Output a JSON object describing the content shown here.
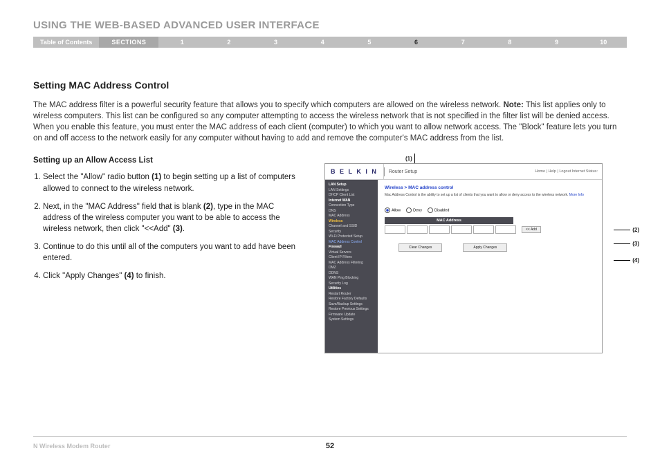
{
  "header": {
    "title": "USING THE WEB-BASED ADVANCED USER INTERFACE"
  },
  "nav": {
    "toc": "Table of Contents",
    "sections": "SECTIONS",
    "items": [
      "1",
      "2",
      "3",
      "4",
      "5",
      "6",
      "7",
      "8",
      "9",
      "10"
    ],
    "active": "6"
  },
  "section": {
    "title": "Setting MAC Address Control"
  },
  "intro": {
    "p1a": "The MAC address filter is a powerful security feature that allows you to specify which computers are allowed on the wireless network. ",
    "noteLabel": "Note:",
    "p1b": " This list applies only to wireless computers. This list can be configured so any computer attempting to access the wireless network that is not specified in the filter list will be denied access. When you enable this feature, you must enter the MAC address of each client (computer) to which you want to allow network access. The \"Block\" feature lets you turn on and off access to the network easily for any computer without having to add and remove the computer's MAC address from the list."
  },
  "sub": {
    "title": "Setting up an Allow Access List"
  },
  "steps": [
    {
      "a": "Select the \"Allow\" radio button ",
      "b": "(1)",
      "c": " to begin setting up a list of computers allowed to connect to the wireless network."
    },
    {
      "a": "Next, in the \"MAC Address\" field that is blank ",
      "b": "(2)",
      "c": ", type in the MAC address of the wireless computer you want to be able to access the wireless network, then click \"<<Add\" ",
      "d": "(3)",
      "e": "."
    },
    {
      "a": "Continue to do this until all of the computers you want to add have been entered.",
      "b": "",
      "c": ""
    },
    {
      "a": "Click \"Apply Changes\" ",
      "b": "(4)",
      "c": " to finish."
    }
  ],
  "callouts": {
    "c1": "(1)",
    "c2": "(2)",
    "c3": "(3)",
    "c4": "(4)"
  },
  "shot": {
    "logo": "B E L K I N",
    "rsetup": "Router Setup",
    "toplinks": "Home | Help | Logout  Internet Status:",
    "sidebar": {
      "g1": "LAN Setup",
      "g1a": "LAN Settings",
      "g1b": "DHCP Client List",
      "g2": "Internet WAN",
      "g2a": "Connection Type",
      "g2b": "DNS",
      "g2c": "MAC Address",
      "g3": "Wireless",
      "g3a": "Channel and SSID",
      "g3b": "Security",
      "g3c": "Wi-Fi Protected Setup",
      "g3d": "MAC Address Control",
      "g4": "Firewall",
      "g4a": "Virtual Servers",
      "g4b": "Client IP Filters",
      "g4c": "MAC Address Filtering",
      "g4d": "DMZ",
      "g4e": "DDNS",
      "g4f": "WAN Ping Blocking",
      "g4g": "Security Log",
      "g5": "Utilities",
      "g5a": "Restart Router",
      "g5b": "Restore Factory Defaults",
      "g5c": "Save/Backup Settings",
      "g5d": "Restore Previous Settings",
      "g5e": "Firmware Update",
      "g5f": "System Settings"
    },
    "main": {
      "crumb": "Wireless > MAC address control",
      "desc": "Mac Address Control is the ability to set up a list of clients that you want to allow or deny access to the wireless network. ",
      "more": "More Info",
      "rAllow": "Allow",
      "rDeny": "Deny",
      "rDisabled": "Disabled",
      "th": "MAC Address",
      "add": "<< Add",
      "clear": "Clear Changes",
      "apply": "Apply Changes"
    }
  },
  "footer": {
    "product": "N Wireless Modem Router",
    "page": "52"
  }
}
